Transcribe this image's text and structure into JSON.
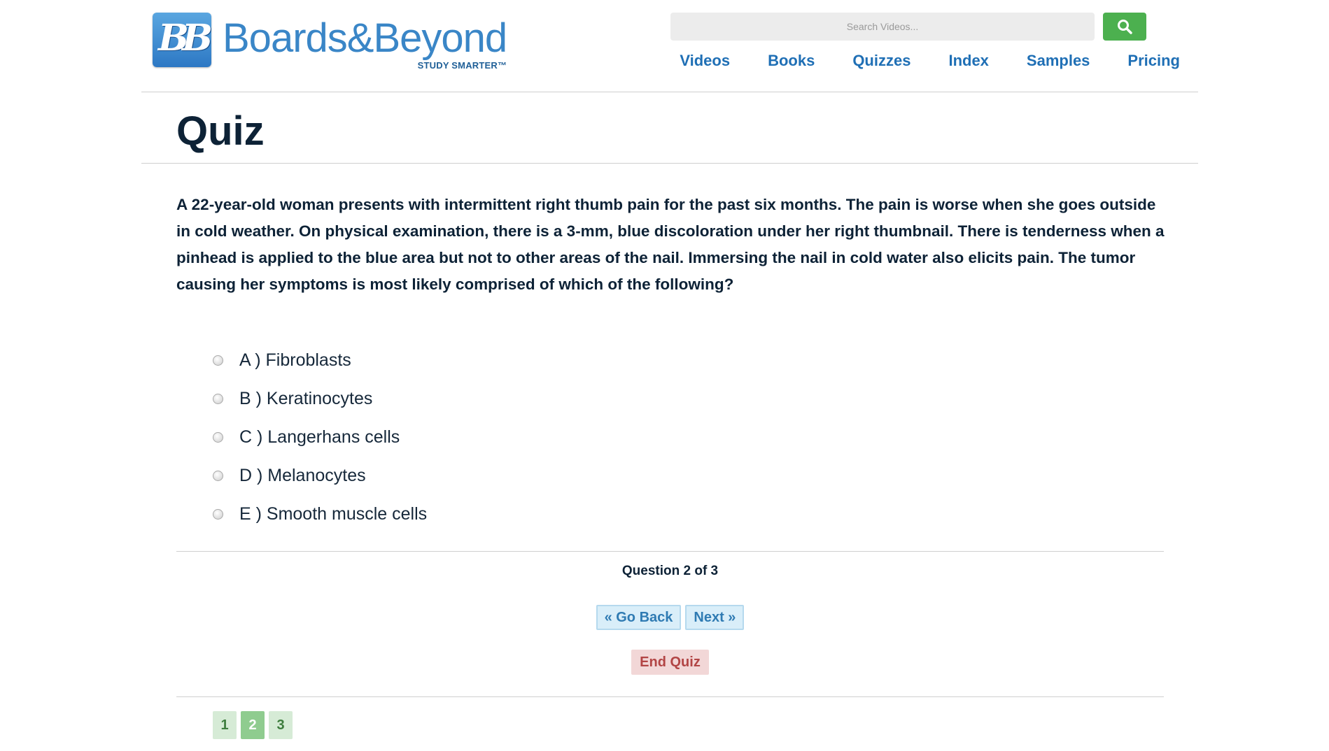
{
  "header": {
    "logo_mark": "BB",
    "logo_name": "Boards&Beyond",
    "logo_tagline": "STUDY SMARTER™",
    "search_placeholder": "Search Videos...",
    "search_icon": "search-icon",
    "nav": [
      "Videos",
      "Books",
      "Quizzes",
      "Index",
      "Samples",
      "Pricing"
    ]
  },
  "page": {
    "title": "Quiz"
  },
  "quiz": {
    "question": "A 22-year-old woman presents with intermittent right thumb pain for the past six months. The pain is worse when she goes outside in cold weather. On physical examination, there is a 3-mm, blue discoloration under her right thumbnail. There is tenderness when a pinhead is applied to the blue area but not to other areas of the nail. Immersing the nail in cold water also elicits pain. The tumor causing her symptoms is most likely comprised of which of the following?",
    "options": [
      "A ) Fibroblasts",
      "B ) Keratinocytes",
      "C ) Langerhans cells",
      "D ) Melanocytes",
      "E ) Smooth muscle cells"
    ],
    "counter": "Question 2 of 3",
    "go_back_label": "« Go Back",
    "next_label": "Next »",
    "end_label": "End Quiz",
    "pages": [
      "1",
      "2",
      "3"
    ],
    "current_page": "2"
  },
  "colors": {
    "brand_blue": "#1f6fb5",
    "search_green": "#4cb04f",
    "end_red": "#b24545",
    "page_green": "#8fcc8f"
  }
}
